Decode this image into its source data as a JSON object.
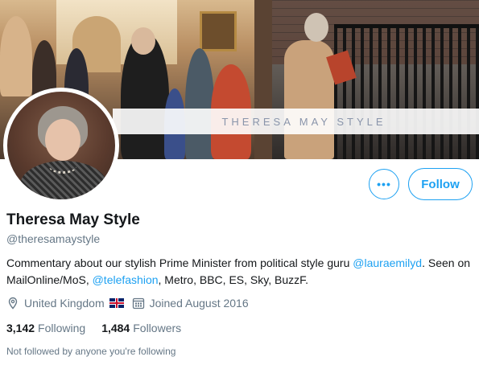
{
  "banner": {
    "text": "THERESA MAY STYLE"
  },
  "profile": {
    "name": "Theresa May Style",
    "handle": "@theresamaystyle",
    "bio": {
      "part1": "Commentary about our stylish Prime Minister from political style guru ",
      "mention1": "@lauraemilyd",
      "part2": ". Seen on MailOnline/MoS, ",
      "mention2": "@telefashion",
      "part3": ", Metro, BBC, ES, Sky, BuzzF."
    },
    "location": "United Kingdom",
    "joined": "Joined August 2016"
  },
  "actions": {
    "follow_label": "Follow",
    "more_icon": "more-horizontal-icon"
  },
  "stats": {
    "following_count": "3,142",
    "following_label": "Following",
    "followers_count": "1,484",
    "followers_label": "Followers"
  },
  "note": "Not followed by anyone you're following",
  "colors": {
    "accent": "#1da1f2",
    "secondary_text": "#657786",
    "primary_text": "#14171a"
  }
}
